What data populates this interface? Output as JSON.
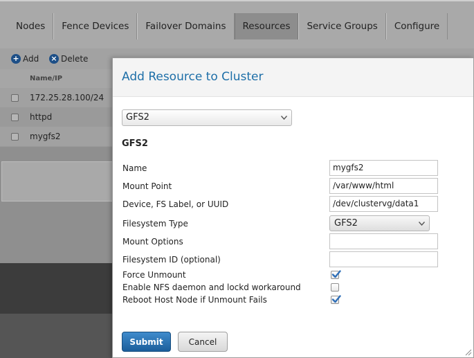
{
  "nav": {
    "tabs": [
      {
        "label": "Nodes"
      },
      {
        "label": "Fence Devices"
      },
      {
        "label": "Failover Domains"
      },
      {
        "label": "Resources",
        "active": true
      },
      {
        "label": "Service Groups"
      },
      {
        "label": "Configure"
      }
    ]
  },
  "toolbar": {
    "add_label": "Add",
    "delete_label": "Delete"
  },
  "resource_list": {
    "column_header": "Name/IP",
    "rows": [
      {
        "name": "172.25.28.100/24"
      },
      {
        "name": "httpd"
      },
      {
        "name": "mygfs2"
      }
    ]
  },
  "dialog": {
    "title": "Add Resource to Cluster",
    "resource_type": "GFS2",
    "section_title": "GFS2",
    "fields": {
      "name": {
        "label": "Name",
        "value": "mygfs2"
      },
      "mount_point": {
        "label": "Mount Point",
        "value": "/var/www/html"
      },
      "device": {
        "label": "Device, FS Label, or UUID",
        "value": "/dev/clustervg/data1"
      },
      "fs_type": {
        "label": "Filesystem Type",
        "value": "GFS2"
      },
      "mount_options": {
        "label": "Mount Options",
        "value": ""
      },
      "fs_id": {
        "label": "Filesystem ID (optional)",
        "value": ""
      },
      "force_unmount": {
        "label": "Force Unmount",
        "checked": true
      },
      "nfs_workaround": {
        "label": "Enable NFS daemon and lockd workaround",
        "checked": false
      },
      "reboot_host": {
        "label": "Reboot Host Node if Unmount Fails",
        "checked": true
      }
    },
    "submit_label": "Submit",
    "cancel_label": "Cancel"
  },
  "colors": {
    "accent": "#1e6fa8",
    "submit_button": "#2a6fb0",
    "checkmark": "#2f6fb8"
  }
}
